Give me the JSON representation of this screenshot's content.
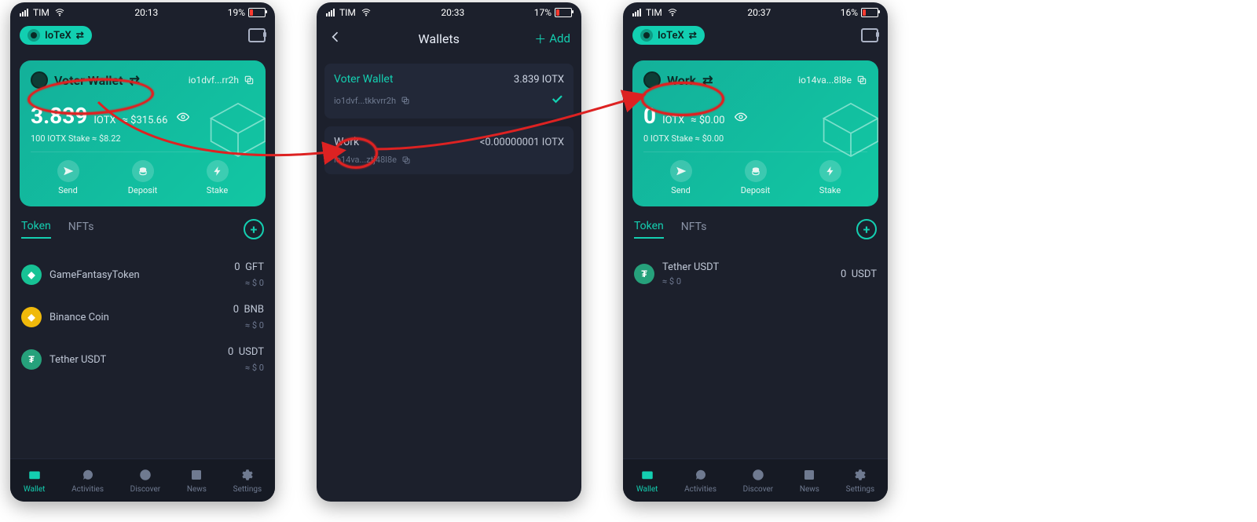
{
  "statusbar": {
    "carrier": "TIM",
    "p1": {
      "time": "20:13",
      "battery": "19%"
    },
    "p2": {
      "time": "20:33",
      "battery": "17%"
    },
    "p3": {
      "time": "20:37",
      "battery": "16%"
    }
  },
  "network_chip": {
    "label": "IoTeX"
  },
  "screens": {
    "wallet1": {
      "wallet_name": "Voter Wallet",
      "address_short": "io1dvf...rr2h",
      "balance_value": "3.839",
      "balance_unit": "IOTX",
      "balance_fiat": "≈ $315.66",
      "stake_line": "100 IOTX Stake ≈ $8.22",
      "actions": {
        "send": "Send",
        "deposit": "Deposit",
        "stake": "Stake"
      },
      "tabs": {
        "token": "Token",
        "nfts": "NFTs"
      },
      "tokens": [
        {
          "name": "GameFantasyToken",
          "amount": "0",
          "symbol": "GFT",
          "fiat": "≈ $ 0",
          "color": "#17c295"
        },
        {
          "name": "Binance Coin",
          "amount": "0",
          "symbol": "BNB",
          "fiat": "≈ $ 0",
          "color": "#f0b90b"
        },
        {
          "name": "Tether USDT",
          "amount": "0",
          "symbol": "USDT",
          "fiat": "≈ $ 0",
          "color": "#26a17b"
        }
      ]
    },
    "wallets_list": {
      "title": "Wallets",
      "add_label": "Add",
      "items": [
        {
          "name": "Voter Wallet",
          "amount": "3.839 IOTX",
          "address": "io1dvf...tkkvrr2h",
          "selected": true
        },
        {
          "name": "Work",
          "amount": "<0.00000001 IOTX",
          "address": "io14va...ztj48l8e",
          "selected": false
        }
      ]
    },
    "wallet3": {
      "wallet_name": "Work",
      "address_short": "io14va...8l8e",
      "balance_value": "0",
      "balance_unit": "IOTX",
      "balance_fiat": "≈ $0.00",
      "stake_line": "0 IOTX Stake ≈ $0.00",
      "actions": {
        "send": "Send",
        "deposit": "Deposit",
        "stake": "Stake"
      },
      "tabs": {
        "token": "Token",
        "nfts": "NFTs"
      },
      "tokens": [
        {
          "name": "Tether USDT",
          "sub": "≈ $ 0",
          "amount": "0",
          "symbol": "USDT",
          "color": "#26a17b"
        }
      ]
    }
  },
  "bottomnav": {
    "wallet": "Wallet",
    "activities": "Activities",
    "discover": "Discover",
    "news": "News",
    "settings": "Settings"
  }
}
